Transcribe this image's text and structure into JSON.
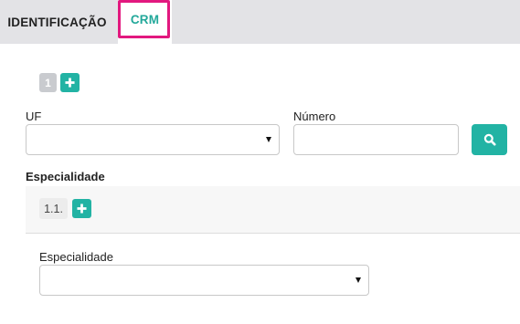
{
  "tabs": [
    {
      "label": "IDENTIFICAÇÃO",
      "active": false
    },
    {
      "label": "CRM",
      "active": true
    }
  ],
  "crm": {
    "index_badge": "1",
    "uf": {
      "label": "UF",
      "value": ""
    },
    "numero": {
      "label": "Número",
      "value": ""
    }
  },
  "especialidade_section": {
    "title": "Especialidade",
    "index_badge": "1.1.",
    "field": {
      "label": "Especialidade",
      "value": ""
    }
  },
  "colors": {
    "accent": "#22b3a4",
    "tab_active_text": "#22a89a",
    "highlight_border": "#e2187f",
    "tabbar_bg": "#e3e3e6"
  },
  "icons": {
    "add": "plus-icon",
    "search": "search-icon",
    "dropdown": "caret-down-icon"
  }
}
